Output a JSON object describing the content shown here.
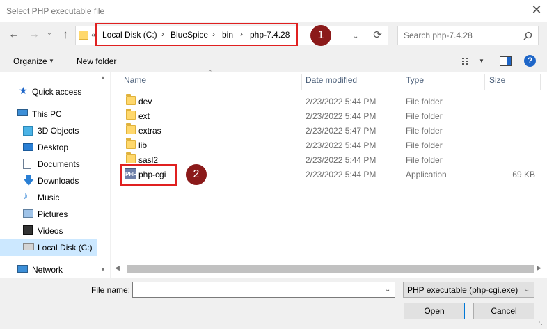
{
  "window": {
    "title": "Select PHP executable file",
    "close_icon": "close-icon"
  },
  "address": {
    "overflow": "«",
    "crumbs": [
      "Local Disk (C:)",
      "BlueSpice",
      "bin",
      "php-7.4.28"
    ],
    "separator": "›"
  },
  "search": {
    "placeholder": "Search php-7.4.28"
  },
  "toolbar": {
    "organize": "Organize",
    "new_folder": "New folder",
    "help": "?"
  },
  "nav": {
    "items": [
      {
        "label": "Quick access",
        "icon": "star-icon"
      },
      {
        "label": "This PC",
        "icon": "computer-icon"
      },
      {
        "label": "3D Objects",
        "icon": "cube-icon"
      },
      {
        "label": "Desktop",
        "icon": "desktop-icon"
      },
      {
        "label": "Documents",
        "icon": "documents-icon"
      },
      {
        "label": "Downloads",
        "icon": "download-icon"
      },
      {
        "label": "Music",
        "icon": "music-icon"
      },
      {
        "label": "Pictures",
        "icon": "pictures-icon"
      },
      {
        "label": "Videos",
        "icon": "videos-icon"
      },
      {
        "label": "Local Disk (C:)",
        "icon": "drive-icon"
      },
      {
        "label": "Network",
        "icon": "network-icon"
      }
    ]
  },
  "columns": {
    "name": "Name",
    "date": "Date modified",
    "type": "Type",
    "size": "Size"
  },
  "files": [
    {
      "name": "dev",
      "date": "2/23/2022 5:44 PM",
      "type": "File folder",
      "size": ""
    },
    {
      "name": "ext",
      "date": "2/23/2022 5:44 PM",
      "type": "File folder",
      "size": ""
    },
    {
      "name": "extras",
      "date": "2/23/2022 5:47 PM",
      "type": "File folder",
      "size": ""
    },
    {
      "name": "lib",
      "date": "2/23/2022 5:44 PM",
      "type": "File folder",
      "size": ""
    },
    {
      "name": "sasl2",
      "date": "2/23/2022 5:44 PM",
      "type": "File folder",
      "size": ""
    },
    {
      "name": "php-cgi",
      "date": "2/23/2022 5:44 PM",
      "type": "Application",
      "size": "69 KB"
    }
  ],
  "php_icon_text": "PHP",
  "bottom": {
    "file_name_label": "File name:",
    "file_name_value": "",
    "filter": "PHP executable (php-cgi.exe)",
    "open": "Open",
    "cancel": "Cancel"
  },
  "annotations": {
    "badge1": "1",
    "badge2": "2"
  },
  "colors": {
    "annotation_red": "#e02020",
    "badge": "#8b1a1a",
    "selected": "#cce8ff",
    "help": "#1e66c8"
  }
}
